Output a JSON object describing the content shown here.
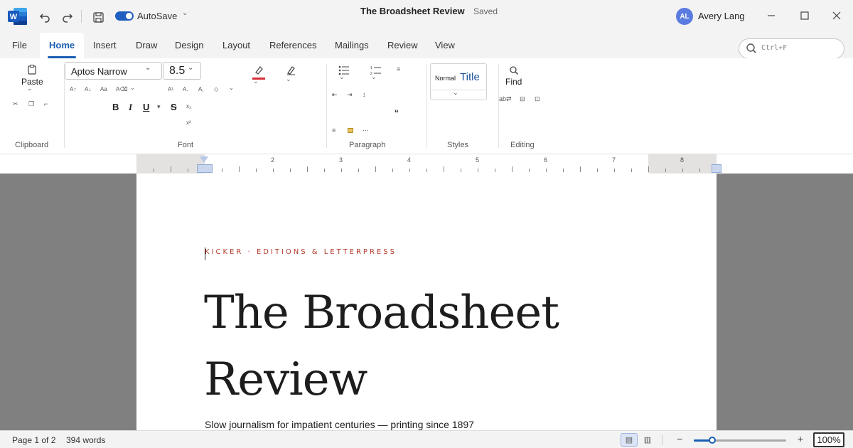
{
  "app": {
    "document_title": "The Broadsheet Review",
    "save_status": "Saved",
    "autosave_label": "AutoSave",
    "user": {
      "initials": "AL",
      "name": "Avery Lang"
    }
  },
  "tabs": [
    {
      "label": "File"
    },
    {
      "label": "Home",
      "active": true
    },
    {
      "label": "Insert"
    },
    {
      "label": "Draw"
    },
    {
      "label": "Design"
    },
    {
      "label": "Layout"
    },
    {
      "label": "References"
    },
    {
      "label": "Mailings"
    },
    {
      "label": "Review"
    },
    {
      "label": "View"
    }
  ],
  "search": {
    "placeholder": "Ctrl+F"
  },
  "ribbon": {
    "clipboard": {
      "paste_label": "Paste",
      "group_label": "Clipboard"
    },
    "font": {
      "family": "Aptos Narrow",
      "size": "8.5",
      "group_label": "Font",
      "bold": "B",
      "italic": "I",
      "underline": "U",
      "strikethrough": "S",
      "highlight_color": "#d6303a"
    },
    "paragraph": {
      "group_label": "Paragraph",
      "quote_glyph": "“"
    },
    "styles": {
      "normal": "Normal",
      "title": "Title",
      "group_label": "Styles"
    },
    "editing": {
      "find_label": "Find",
      "replace_glyph": "ab⇄",
      "group_label": "Editing"
    }
  },
  "ruler": {
    "numbers": [
      "2",
      "3",
      "4",
      "5",
      "6",
      "7",
      "8"
    ]
  },
  "document": {
    "kicker": "KICKER · EDITIONS & LETTERPRESS",
    "headline_line1": "The Broadsheet",
    "headline_line2": "Review",
    "subtitle": "Slow journalism for impatient centuries — printing since 1897"
  },
  "status": {
    "page": "Page 1 of 2",
    "words": "394 words",
    "zoom": "100%",
    "zoom_level_fraction": 0.2
  },
  "colors": {
    "accent": "#1a5fb4",
    "kicker": "#b23a2a",
    "canvas": "#808080"
  }
}
